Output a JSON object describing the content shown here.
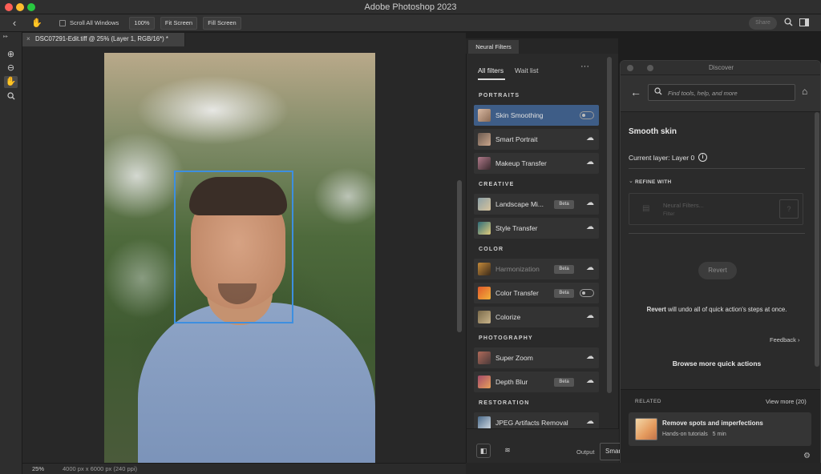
{
  "window": {
    "title": "Adobe Photoshop 2023"
  },
  "options_bar": {
    "back_icon": "chevron-left-icon",
    "hand_icon": "hand-icon",
    "scroll_all_windows_label": "Scroll All Windows",
    "zoom_100_label": "100%",
    "fit_screen_label": "Fit Screen",
    "fill_screen_label": "Fill Screen",
    "share_label": "Share",
    "search_icon": "search-icon",
    "workspace_icon": "workspace-icon"
  },
  "toolbar": {
    "tools": [
      {
        "name": "zoom-in-icon",
        "glyph": "⊕"
      },
      {
        "name": "zoom-out-icon",
        "glyph": "⊖"
      },
      {
        "name": "hand-tool-icon",
        "glyph": "✋"
      },
      {
        "name": "zoom-tool-icon",
        "glyph": "🔍"
      }
    ]
  },
  "document": {
    "tab_label": "DSC07291-Edit.tiff @ 25% (Layer 1, RGB/16*) *",
    "close_glyph": "×",
    "zoom_level": "25%",
    "dimensions": "4000 px x 6000 px (240 ppi)"
  },
  "neural_filters": {
    "panel_tab": "Neural Filters",
    "tabs": [
      "All filters",
      "Wait list"
    ],
    "more_glyph": "···",
    "categories": [
      {
        "label": "PORTRAITS",
        "items": [
          {
            "label": "Skin Smoothing",
            "state": "toggle",
            "selected": true
          },
          {
            "label": "Smart Portrait",
            "state": "cloud"
          },
          {
            "label": "Makeup Transfer",
            "state": "cloud"
          }
        ]
      },
      {
        "label": "CREATIVE",
        "items": [
          {
            "label": "Landscape Mi...",
            "beta": "Beta",
            "state": "cloud"
          },
          {
            "label": "Style Transfer",
            "state": "cloud"
          }
        ]
      },
      {
        "label": "COLOR",
        "items": [
          {
            "label": "Harmonization",
            "beta": "Beta",
            "state": "cloud",
            "dim": true
          },
          {
            "label": "Color Transfer",
            "beta": "Beta",
            "state": "toggle"
          },
          {
            "label": "Colorize",
            "state": "cloud"
          }
        ]
      },
      {
        "label": "PHOTOGRAPHY",
        "items": [
          {
            "label": "Super Zoom",
            "state": "cloud"
          },
          {
            "label": "Depth Blur",
            "beta": "Beta",
            "state": "cloud"
          }
        ]
      },
      {
        "label": "RESTORATION",
        "items": [
          {
            "label": "JPEG Artifacts Removal",
            "state": "cloud"
          }
        ]
      }
    ],
    "output_label": "Output",
    "output_value": "Smart Object"
  },
  "discover": {
    "title": "Discover",
    "search_placeholder": "Find tools, help, and more",
    "heading": "Smooth skin",
    "current_layer": "Current layer: Layer 0",
    "refine_with": "REFINE WITH",
    "filter_card_title": "Neural Filters...",
    "filter_card_sub": "Filter",
    "revert_label": "Revert",
    "revert_note_bold": "Revert",
    "revert_note_rest": " will undo all of quick action's steps at once.",
    "feedback_label": "Feedback",
    "browse_label": "Browse more quick actions",
    "related_label": "RELATED",
    "view_more_label": "View more (20)",
    "related_item": {
      "title": "Remove spots and imperfections",
      "subtitle": "Hands-on tutorials",
      "duration": "5 min"
    }
  }
}
